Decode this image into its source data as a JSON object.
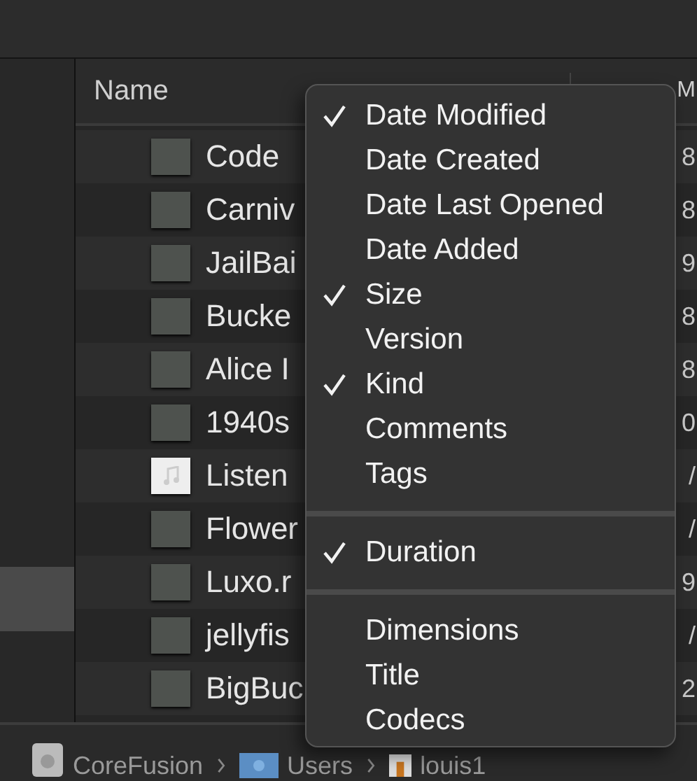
{
  "columns": [
    {
      "label": "Name"
    },
    {
      "label": "M"
    }
  ],
  "sidebar": {
    "items": [
      {
        "selected": true
      }
    ]
  },
  "rows": [
    {
      "name": "Code",
      "column_2": "8",
      "kind": "video"
    },
    {
      "name": "Carniv",
      "column_2": "8",
      "kind": "video"
    },
    {
      "name": "JailBai",
      "column_2": "9",
      "kind": "video"
    },
    {
      "name": "Bucke",
      "column_2": "8",
      "kind": "video"
    },
    {
      "name": "Alice I",
      "column_2": "8",
      "kind": "video"
    },
    {
      "name": "1940s",
      "column_2": "0",
      "kind": "video"
    },
    {
      "name": "Listen",
      "column_2": "/",
      "kind": "audio"
    },
    {
      "name": "Flower",
      "column_2": "/",
      "kind": "video"
    },
    {
      "name": "Luxo.r",
      "column_2": "9",
      "kind": "video"
    },
    {
      "name": "jellyfis",
      "column_2": "/",
      "kind": "video"
    },
    {
      "name": "BigBuc",
      "column_2": "2",
      "kind": "video"
    }
  ],
  "menu": {
    "sections": [
      {
        "items": [
          {
            "label": "Date Modified",
            "checked": true
          },
          {
            "label": "Date Created",
            "checked": false
          },
          {
            "label": "Date Last Opened",
            "checked": false
          },
          {
            "label": "Date Added",
            "checked": false
          },
          {
            "label": "Size",
            "checked": true
          },
          {
            "label": "Version",
            "checked": false
          },
          {
            "label": "Kind",
            "checked": true
          },
          {
            "label": "Comments",
            "checked": false
          },
          {
            "label": "Tags",
            "checked": false
          }
        ]
      },
      {
        "items": [
          {
            "label": "Duration",
            "checked": true
          }
        ]
      },
      {
        "items": [
          {
            "label": "Dimensions",
            "checked": false
          },
          {
            "label": "Title",
            "checked": false
          },
          {
            "label": "Codecs",
            "checked": false
          }
        ]
      }
    ]
  },
  "path_bar": [
    {
      "label": "CoreFusion",
      "kind": "drive"
    },
    {
      "label": "Users",
      "kind": "folder"
    },
    {
      "label": "louis1",
      "kind": "home"
    }
  ]
}
